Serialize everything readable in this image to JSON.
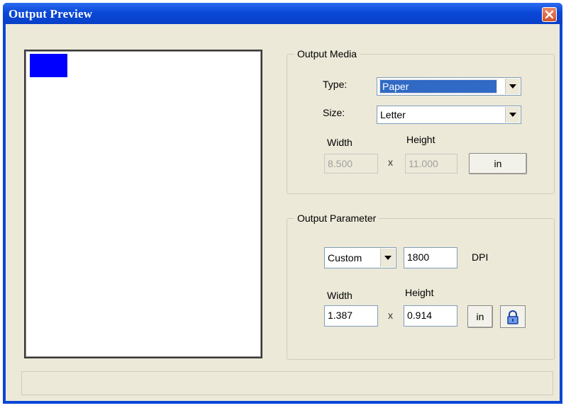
{
  "window": {
    "title": "Output Preview"
  },
  "icons": {
    "close": "close-icon",
    "lock": "lock-icon",
    "dropdown": "chevron-down-icon"
  },
  "colors": {
    "titlebar": "#0a48d8",
    "preview_rect": "#0000ff",
    "dialog_bg": "#ece9d8"
  },
  "output_media": {
    "legend": "Output Media",
    "type_label": "Type:",
    "type_value": "Paper",
    "size_label": "Size:",
    "size_value": "Letter",
    "width_label": "Width",
    "height_label": "Height",
    "width_value": "8.500",
    "height_value": "11.000",
    "times": "x",
    "unit_button": "in"
  },
  "output_parameter": {
    "legend": "Output Parameter",
    "resolution_mode": "Custom",
    "dpi_value": "1800",
    "dpi_label": "DPI",
    "width_label": "Width",
    "height_label": "Height",
    "width_value": "1.387",
    "height_value": "0.914",
    "times": "x",
    "unit_button": "in"
  },
  "status": {
    "text": ""
  }
}
